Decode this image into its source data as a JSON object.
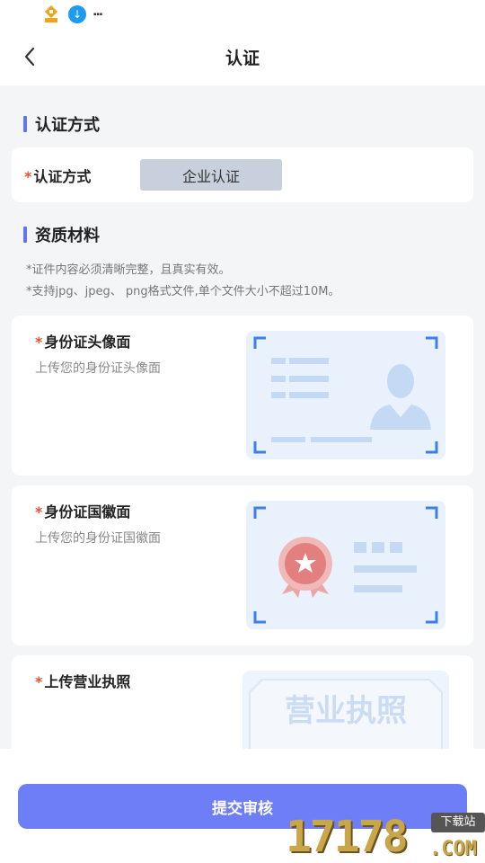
{
  "nav": {
    "title": "认证"
  },
  "section_method": {
    "title": "认证方式"
  },
  "method_card": {
    "required_mark": "*",
    "label": "认证方式",
    "selected": "企业认证"
  },
  "section_materials": {
    "title": "资质材料"
  },
  "hints": [
    "*证件内容必须清晰完整，且真实有效。",
    "*支持jpg、jpeg、 png格式文件,单个文件大小不超过10M。"
  ],
  "uploads": [
    {
      "required_mark": "*",
      "title": "身份证头像面",
      "subtitle": "上传您的身份证头像面",
      "icon": "id-card-front-icon"
    },
    {
      "required_mark": "*",
      "title": "身份证国徽面",
      "subtitle": "上传您的身份证国徽面",
      "icon": "id-card-emblem-icon"
    },
    {
      "required_mark": "*",
      "title": "上传营业执照",
      "subtitle": "",
      "icon": "business-license-icon",
      "placeholder_text": "营业执照"
    }
  ],
  "submit": {
    "label": "提交审核"
  },
  "watermark": {
    "digits": "17178",
    "suffix": ".COM",
    "tag": "下载站"
  },
  "colors": {
    "accent": "#6e7ef7",
    "section_bar": "#6473f0",
    "required": "#e5532f",
    "chip_bg": "#c9d0dd",
    "upload_bg": "#e8f1fc",
    "upload_corner": "#3f7ee8"
  }
}
